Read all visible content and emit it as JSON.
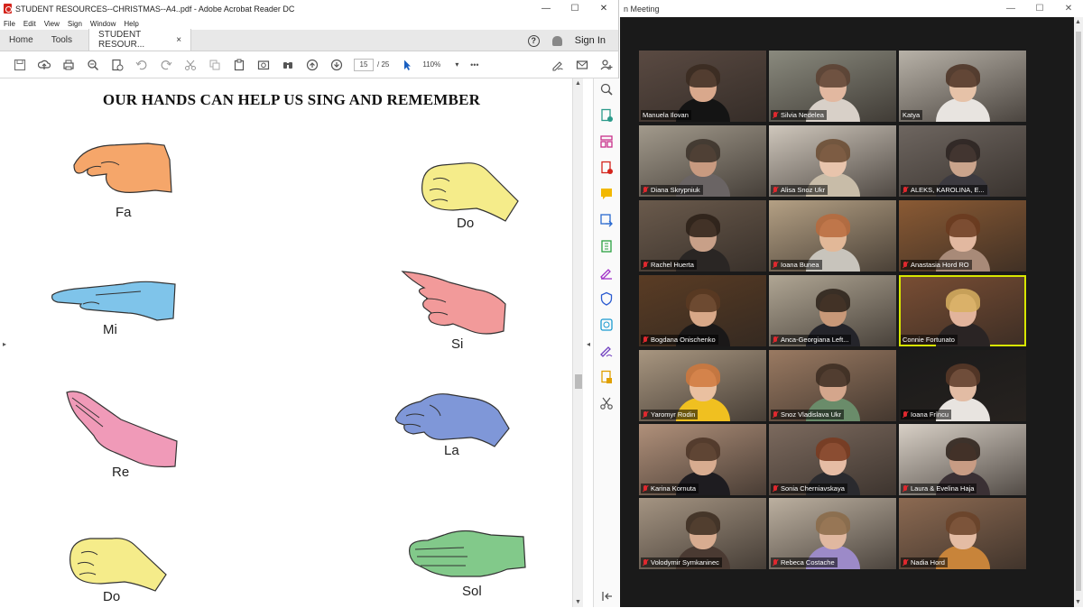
{
  "acrobat": {
    "window_title": "STUDENT RESOURCES--CHRISTMAS--A4..pdf - Adobe Acrobat Reader DC",
    "window_buttons": [
      "—",
      "☐",
      "✕"
    ],
    "menu": [
      "File",
      "Edit",
      "View",
      "Sign",
      "Window",
      "Help"
    ],
    "tabs": {
      "home": "Home",
      "tools": "Tools",
      "doc": "STUDENT RESOUR...",
      "close": "×"
    },
    "signin": "Sign In",
    "page_current": "15",
    "page_total": "/ 25",
    "zoom": "110%",
    "more": "•••",
    "document": {
      "title": "OUR HANDS CAN HELP US SING AND REMEMBER",
      "hand_labels": {
        "fa": "Fa",
        "mi": "Mi",
        "re": "Re",
        "do_low": "Do",
        "do_high": "Do",
        "si": "Si",
        "la": "La",
        "sol": "Sol"
      }
    },
    "colors": {
      "fa": "#f5a66a",
      "mi": "#7fc4ea",
      "re": "#f09ab8",
      "do": "#f5ec8a",
      "si": "#f29a9a",
      "la": "#7f97d8",
      "sol": "#82c98a"
    }
  },
  "zoom": {
    "window_title": "n Meeting",
    "window_buttons": [
      "—",
      "☐",
      "✕"
    ],
    "participants": [
      {
        "name": "Manuela Ilovan",
        "muted": false,
        "bg": "#5a4a42",
        "skin": "#d9a88c",
        "hair": "#3a2a20",
        "shirt": "#141414",
        "active": false
      },
      {
        "name": "Silvia Nedelea",
        "muted": true,
        "bg": "#8a8a7e",
        "skin": "#e2b8a0",
        "hair": "#5a4030",
        "shirt": "#d8d0c8",
        "active": false
      },
      {
        "name": "Katya",
        "muted": false,
        "bg": "#b8b2a8",
        "skin": "#e6c2a8",
        "hair": "#4a3022",
        "shirt": "#e8e4e0",
        "active": false
      },
      {
        "name": "Diana Skrypniuk",
        "muted": true,
        "bg": "#a29a8c",
        "skin": "#c89a80",
        "hair": "#3a3028",
        "shirt": "#6a6464",
        "active": false
      },
      {
        "name": "Alisa Snoz Ukr",
        "muted": true,
        "bg": "#cfc7bc",
        "skin": "#e8c4ac",
        "hair": "#6a4a30",
        "shirt": "#c8bca8",
        "active": false
      },
      {
        "name": "ALEKS, KAROLINA, E...",
        "muted": true,
        "bg": "#6e6660",
        "skin": "#caa48c",
        "hair": "#2a2220",
        "shirt": "#3c3a40",
        "active": false
      },
      {
        "name": "Rachel Huerta",
        "muted": true,
        "bg": "#6a5a4c",
        "skin": "#c8a088",
        "hair": "#2a1e16",
        "shirt": "#2a2624",
        "active": false
      },
      {
        "name": "Ioana Bunea",
        "muted": true,
        "bg": "#b4a084",
        "skin": "#e2b898",
        "hair": "#b86a3c",
        "shirt": "#c8c4bc",
        "active": false
      },
      {
        "name": "Anastasia Hord RO",
        "muted": true,
        "bg": "#8a5a34",
        "skin": "#e2b8a0",
        "hair": "#6a3a1e",
        "shirt": "#a88a78",
        "active": false
      },
      {
        "name": "Bogdana Onischenko",
        "muted": true,
        "bg": "#5a3c24",
        "skin": "#d8a888",
        "hair": "#5a3a22",
        "shirt": "#1a1818",
        "active": false
      },
      {
        "name": "Anca-Georgiana Left...",
        "muted": true,
        "bg": "#b0a694",
        "skin": "#c89878",
        "hair": "#2a2018",
        "shirt": "#24242a",
        "active": false
      },
      {
        "name": "Connie Fortunato",
        "muted": false,
        "bg": "#7a4e34",
        "skin": "#e2b49c",
        "hair": "#d8b060",
        "shirt": "#2a2424",
        "active": true
      },
      {
        "name": "Yaromyr Rodin",
        "muted": true,
        "bg": "#a89680",
        "skin": "#eac0a0",
        "hair": "#d0783c",
        "shirt": "#f0c020",
        "active": false
      },
      {
        "name": "Snoz Vladislava Ukr",
        "muted": true,
        "bg": "#9a7a62",
        "skin": "#d4a68c",
        "hair": "#3a2a20",
        "shirt": "#6a8c6a",
        "active": false
      },
      {
        "name": "Ioana Frîncu",
        "muted": true,
        "bg": "#1a1a1a",
        "skin": "#e2bca4",
        "hair": "#5a3a28",
        "shirt": "#e8e4e0",
        "active": false
      },
      {
        "name": "Karina Kornuta",
        "muted": true,
        "bg": "#b0907a",
        "skin": "#d8ac90",
        "hair": "#4a3224",
        "shirt": "#1e1c20",
        "active": false
      },
      {
        "name": "Sonia Cherniavskaya",
        "muted": true,
        "bg": "#7c6a5e",
        "skin": "#e6bca4",
        "hair": "#7a3a1e",
        "shirt": "#2a2a2e",
        "active": false
      },
      {
        "name": "Laura & Evelina Haja",
        "muted": true,
        "bg": "#d8d0c6",
        "skin": "#c89c84",
        "hair": "#2a1e18",
        "shirt": "#3a3034",
        "active": false
      },
      {
        "name": "Volodymir Symkaninec",
        "muted": true,
        "bg": "#a49482",
        "skin": "#d8ac90",
        "hair": "#3a2a1e",
        "shirt": "#4a3a32",
        "active": false
      },
      {
        "name": "Rebeca Costache",
        "muted": true,
        "bg": "#bcb0a0",
        "skin": "#e0b8a0",
        "hair": "#8a6a48",
        "shirt": "#9c8ac8",
        "active": false
      },
      {
        "name": "Nadia Hord",
        "muted": true,
        "bg": "#8c6a52",
        "skin": "#e4bca4",
        "hair": "#6a4228",
        "shirt": "#c8843a",
        "active": false
      }
    ]
  }
}
